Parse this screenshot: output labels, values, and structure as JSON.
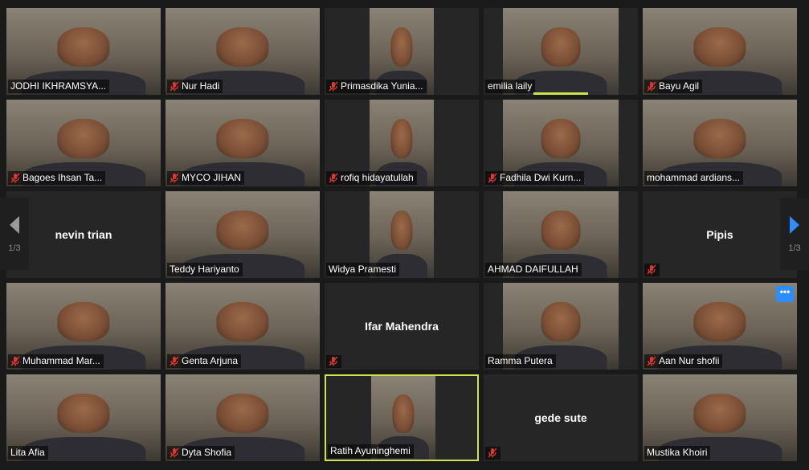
{
  "participants": [
    {
      "name": "JODHI IKHRAMSYA...",
      "muted": false,
      "video": true
    },
    {
      "name": "Nur Hadi",
      "muted": true,
      "video": true
    },
    {
      "name": "Primasdika Yunia...",
      "muted": true,
      "video": true
    },
    {
      "name": "emilia laily",
      "muted": false,
      "video": true,
      "speaking": true
    },
    {
      "name": "Bayu Agil",
      "muted": true,
      "video": true
    },
    {
      "name": "Bagoes Ihsan Ta...",
      "muted": true,
      "video": true
    },
    {
      "name": "MYCO JIHAN",
      "muted": true,
      "video": true
    },
    {
      "name": "rofiq hidayatullah",
      "muted": true,
      "video": true
    },
    {
      "name": "Fadhila Dwi Kurn...",
      "muted": true,
      "video": true
    },
    {
      "name": "mohammad ardians...",
      "muted": false,
      "video": true
    },
    {
      "name": "nevin trian",
      "muted": false,
      "video": false
    },
    {
      "name": "Teddy Hariyanto",
      "muted": false,
      "video": true
    },
    {
      "name": "Widya Pramesti",
      "muted": false,
      "video": true
    },
    {
      "name": "AHMAD DAIFULLAH",
      "muted": false,
      "video": true
    },
    {
      "name": "Pipis",
      "muted": true,
      "video": false
    },
    {
      "name": "Muhammad Mar...",
      "muted": true,
      "video": true
    },
    {
      "name": "Genta Arjuna",
      "muted": true,
      "video": true
    },
    {
      "name": "Ifar Mahendra",
      "muted": true,
      "video": false
    },
    {
      "name": "Ramma Putera",
      "muted": false,
      "video": true
    },
    {
      "name": "Aan Nur shofii",
      "muted": true,
      "video": true,
      "more_button": true
    },
    {
      "name": "Lita Afia",
      "muted": false,
      "video": true
    },
    {
      "name": "Dyta Shofia",
      "muted": true,
      "video": true
    },
    {
      "name": "Ratih Ayuninghemi",
      "muted": false,
      "video": true,
      "active": true
    },
    {
      "name": "gede sute",
      "muted": true,
      "video": false
    },
    {
      "name": "Mustika Khoiri",
      "muted": false,
      "video": true
    }
  ],
  "pagination": {
    "prev_page": "1/3",
    "next_page": "1/3"
  },
  "colors": {
    "background": "#1a1a1a",
    "tile": "#262626",
    "active_border": "#cfe34a",
    "muted_icon": "#e0342c",
    "nav_arrow_next": "#2d8cff",
    "nav_arrow_prev": "#9a9a9a"
  },
  "icons": {
    "muted": "microphone-muted-icon",
    "prev": "chevron-left-icon",
    "next": "chevron-right-icon",
    "more": "more-options-icon"
  },
  "more_button_label": "•••"
}
